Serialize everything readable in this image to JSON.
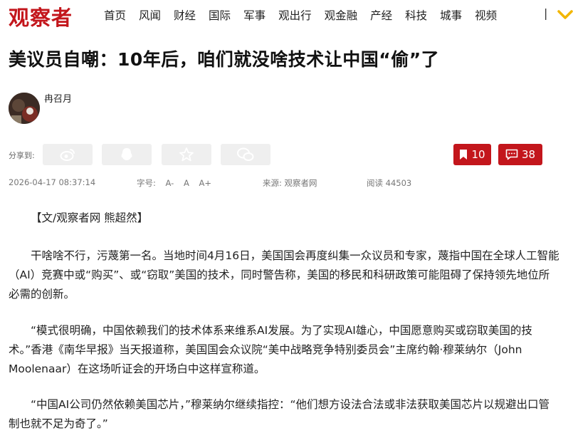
{
  "site": {
    "logo": "观察者"
  },
  "nav": {
    "items": [
      "首页",
      "风闻",
      "财经",
      "国际",
      "军事",
      "观出行",
      "观金融",
      "产经",
      "科技",
      "城事",
      "视频"
    ],
    "separator": "|"
  },
  "article": {
    "title": "美议员自嘲：10年后，咱们就没啥技术让中国“偷”了",
    "author": "冉召月",
    "share_label": "分享到:",
    "bookmark_count": "10",
    "comment_count": "38",
    "date": "2026-04-17 08:37:14",
    "font_size_label": "字号:",
    "font_size_options": [
      "A-",
      "A",
      "A+"
    ],
    "source_label": "来源: 观察者网",
    "read_label": "阅读 44503",
    "paragraphs": [
      "【文/观察者网 熊超然】",
      "干啥啥不行，污蔑第一名。当地时间4月16日，美国国会再度纠集一众议员和专家，蔑指中国在全球人工智能（AI）竞赛中或“购买”、或“窃取”美国的技术，同时警告称，美国的移民和科研政策可能阻碍了保持领先地位所必需的创新。",
      "“模式很明确，中国依赖我们的技术体系来维系AI发展。为了实现AI雄心，中国愿意购买或窃取美国的技术。”香港《南华早报》当天报道称，美国国会众议院“美中战略竞争特别委员会”主席约翰·穆莱纳尔（John Moolenaar）在这场听证会的开场白中这样宣称道。",
      "“中国AI公司仍然依赖美国芯片，”穆莱纳尔继续指控：“他们想方设法合法或非法获取美国芯片以规避出口管制也就不足为奇了。”"
    ]
  },
  "colors": {
    "brand": "#c3161c",
    "share_bg": "#efefef"
  },
  "icons": [
    "weibo-icon",
    "qq-icon",
    "qzone-icon",
    "wechat-icon",
    "bookmark-icon",
    "comment-icon",
    "chevron-down-icon"
  ]
}
